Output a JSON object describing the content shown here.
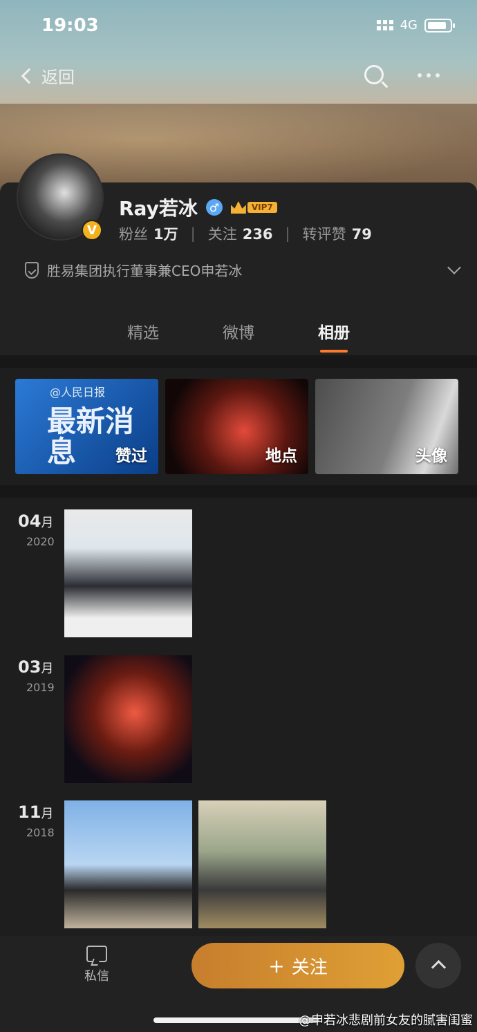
{
  "status_bar": {
    "time": "19:03",
    "network": "4G"
  },
  "nav": {
    "back_label": "返回"
  },
  "profile": {
    "name": "Ray若冰",
    "gender_symbol": "♂",
    "vip_label": "VIP7",
    "verified_badge": "V",
    "stats": [
      {
        "label": "粉丝",
        "value": "1万"
      },
      {
        "label": "关注",
        "value": "236"
      },
      {
        "label": "转评赞",
        "value": "79"
      }
    ],
    "verification": "胜易集团执行董事兼CEO申若冰"
  },
  "tabs": [
    {
      "label": "精选",
      "active": false
    },
    {
      "label": "微博",
      "active": false
    },
    {
      "label": "相册",
      "active": true
    }
  ],
  "albums": [
    {
      "label": "赞过",
      "headline_small": "@人民日报",
      "headline_big": "最新消息"
    },
    {
      "label": "地点"
    },
    {
      "label": "头像"
    }
  ],
  "timeline": [
    {
      "month": "04",
      "unit": "月",
      "year": "2020"
    },
    {
      "month": "03",
      "unit": "月",
      "year": "2019"
    },
    {
      "month": "11",
      "unit": "月",
      "year": "2018"
    }
  ],
  "bottom": {
    "dm_label": "私信",
    "follow_label": "关注",
    "follow_plus": "+"
  },
  "watermark": "@申若冰悲剧前女友的腻害闺蜜",
  "colors": {
    "accent": "#ff7a2a",
    "follow_button": "#d4922f",
    "vip_gold": "#f4b234"
  }
}
